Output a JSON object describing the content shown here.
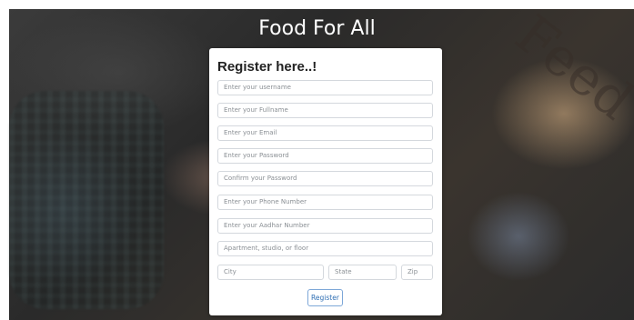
{
  "header": {
    "title": "Food For All"
  },
  "form": {
    "title": "Register here..!",
    "fields": [
      {
        "placeholder": "Enter your username"
      },
      {
        "placeholder": "Enter your Fullname"
      },
      {
        "placeholder": "Enter your Email"
      },
      {
        "placeholder": "Enter your Password"
      },
      {
        "placeholder": "Confirm your Password"
      },
      {
        "placeholder": "Enter your Phone Number"
      },
      {
        "placeholder": "Enter your Aadhar Number"
      },
      {
        "placeholder": "Apartment, studio, or floor"
      }
    ],
    "city_placeholder": "City",
    "state_placeholder": "State",
    "zip_placeholder": "Zip",
    "submit_label": "Register"
  },
  "background": {
    "sign_text": "Feed"
  },
  "colors": {
    "card": "#ffffff",
    "heading_text": "#ffffff",
    "button_text": "#2f6fb4",
    "button_border": "#7da7d8",
    "field_border": "#d4d8dd"
  }
}
